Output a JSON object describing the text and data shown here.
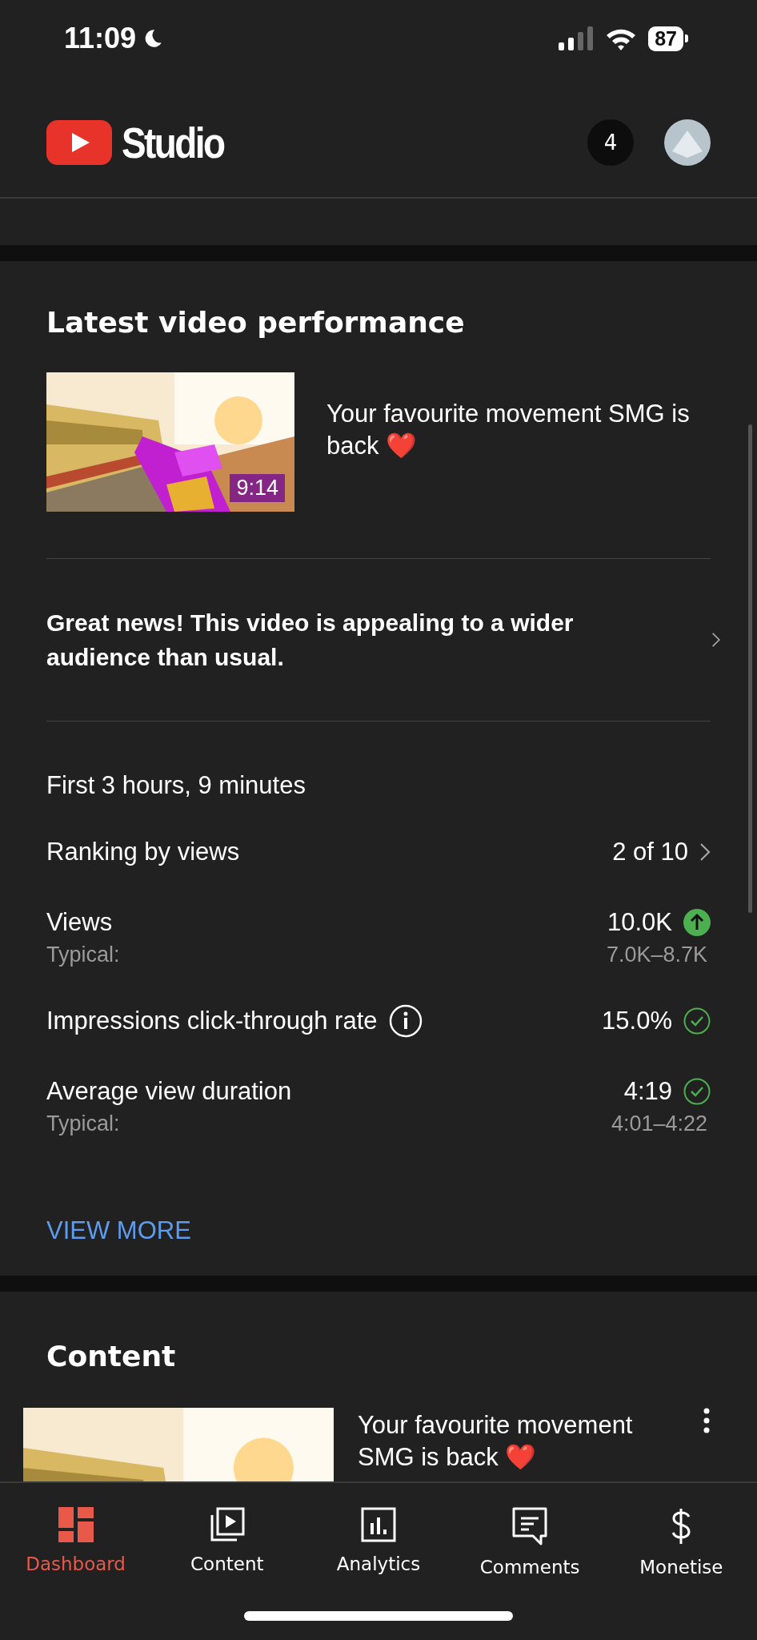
{
  "status_bar": {
    "time": "11:09",
    "do_not_disturb": true,
    "battery": "87"
  },
  "header": {
    "app_name": "Studio",
    "notification_count": "4"
  },
  "latest_video": {
    "title": "Latest video performance",
    "video": {
      "duration": "9:14",
      "title": "Your favourite movement SMG is back ❤️"
    },
    "insight": "Great news! This video is appealing to a wider audience than usual.",
    "period": "First 3 hours, 9 minutes",
    "metrics": [
      {
        "label": "Ranking by views",
        "value": "2 of 10",
        "kind": "ranking",
        "info": false
      },
      {
        "label": "Views",
        "value": "10.0K",
        "kind": "rising",
        "info": false,
        "typical_label": "Typical:",
        "typical_value": "7.0K–8.7K"
      },
      {
        "label": "Impressions click-through rate",
        "value": "15.0%",
        "kind": "good",
        "info": true
      },
      {
        "label": "Average view duration",
        "value": "4:19",
        "kind": "good",
        "info": false,
        "typical_label": "Typical:",
        "typical_value": "4:01–4:22"
      }
    ],
    "view_more": "VIEW MORE"
  },
  "content": {
    "title": "Content",
    "videos": [
      {
        "title": "Your favourite movement SMG is back ❤️"
      }
    ]
  },
  "nav": [
    {
      "kind": "dashboard",
      "label": "Dashboard",
      "selected": true
    },
    {
      "kind": "content",
      "label": "Content",
      "selected": false
    },
    {
      "kind": "analytics",
      "label": "Analytics",
      "selected": false
    },
    {
      "kind": "comments",
      "label": "Comments",
      "selected": false
    },
    {
      "kind": "monetise",
      "label": "Monetise",
      "selected": false
    }
  ]
}
